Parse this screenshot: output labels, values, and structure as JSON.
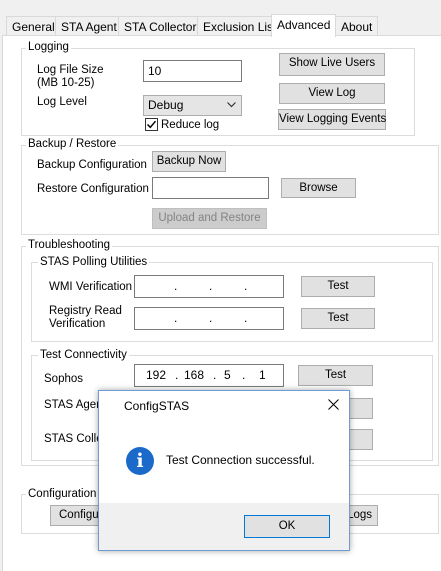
{
  "tabs": [
    {
      "label": "General"
    },
    {
      "label": "STA Agent"
    },
    {
      "label": "STA Collector"
    },
    {
      "label": "Exclusion List"
    },
    {
      "label": "Advanced"
    },
    {
      "label": "About"
    }
  ],
  "logging": {
    "title": "Logging",
    "file_size_label": "Log File Size (MB 10-25)",
    "file_size_value": "10",
    "level_label": "Log Level",
    "level_value": "Debug",
    "reduce_log_label": "Reduce log",
    "reduce_log_checked": true,
    "show_live_users": "Show Live Users",
    "view_log": "View Log",
    "view_logging_events": "View Logging Events"
  },
  "backup": {
    "title": "Backup / Restore",
    "backup_label": "Backup Configuration",
    "backup_now": "Backup Now",
    "restore_label": "Restore Configuration",
    "restore_value": "",
    "browse": "Browse",
    "upload_restore": "Upload and Restore"
  },
  "troubleshooting": {
    "title": "Troubleshooting",
    "polling_title": "STAS Polling Utilities",
    "wmi_label": "WMI Verification",
    "registry_label": "Registry Read Verification",
    "test": "Test",
    "connectivity_title": "Test Connectivity",
    "sophos_label": "Sophos",
    "sophos_ip": [
      "192",
      "168",
      "5",
      "1"
    ],
    "agent_label": "STAS Agen",
    "collector_label": "STAS Colle"
  },
  "config_section": {
    "title": "Configuration S",
    "left_button": "Configura",
    "right_button": "Logs"
  },
  "dialog": {
    "title": "ConfigSTAS",
    "message": "Test Connection successful.",
    "ok": "OK",
    "icon_glyph": "i"
  }
}
